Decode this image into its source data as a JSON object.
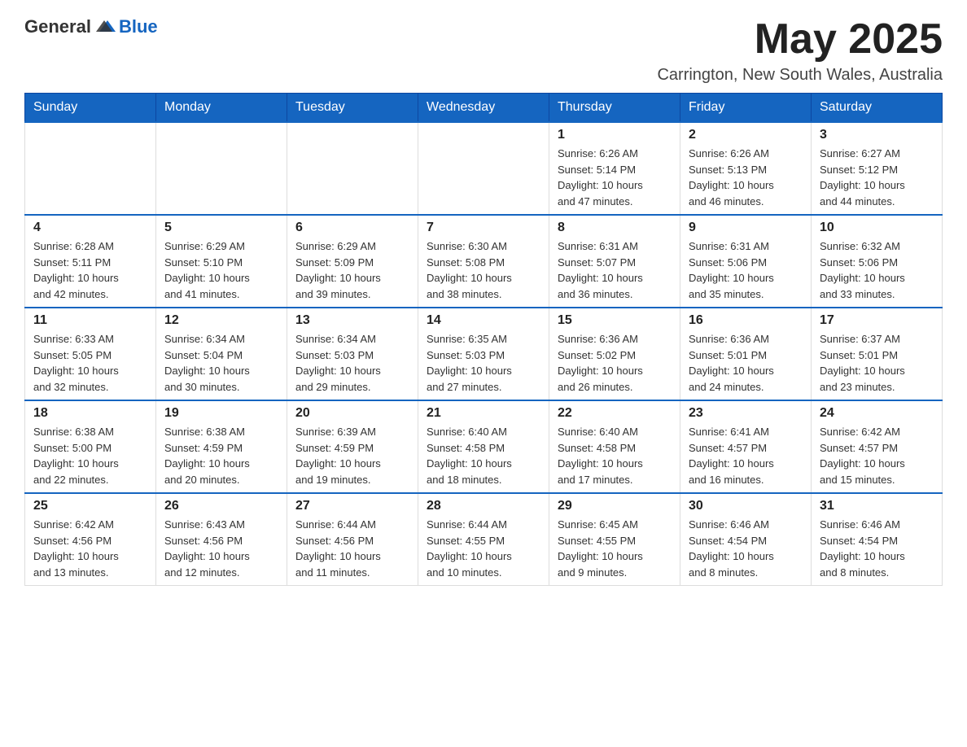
{
  "header": {
    "logo_general": "General",
    "logo_blue": "Blue",
    "month_title": "May 2025",
    "location": "Carrington, New South Wales, Australia"
  },
  "days_of_week": [
    "Sunday",
    "Monday",
    "Tuesday",
    "Wednesday",
    "Thursday",
    "Friday",
    "Saturday"
  ],
  "weeks": [
    [
      {
        "day": "",
        "info": ""
      },
      {
        "day": "",
        "info": ""
      },
      {
        "day": "",
        "info": ""
      },
      {
        "day": "",
        "info": ""
      },
      {
        "day": "1",
        "info": "Sunrise: 6:26 AM\nSunset: 5:14 PM\nDaylight: 10 hours\nand 47 minutes."
      },
      {
        "day": "2",
        "info": "Sunrise: 6:26 AM\nSunset: 5:13 PM\nDaylight: 10 hours\nand 46 minutes."
      },
      {
        "day": "3",
        "info": "Sunrise: 6:27 AM\nSunset: 5:12 PM\nDaylight: 10 hours\nand 44 minutes."
      }
    ],
    [
      {
        "day": "4",
        "info": "Sunrise: 6:28 AM\nSunset: 5:11 PM\nDaylight: 10 hours\nand 42 minutes."
      },
      {
        "day": "5",
        "info": "Sunrise: 6:29 AM\nSunset: 5:10 PM\nDaylight: 10 hours\nand 41 minutes."
      },
      {
        "day": "6",
        "info": "Sunrise: 6:29 AM\nSunset: 5:09 PM\nDaylight: 10 hours\nand 39 minutes."
      },
      {
        "day": "7",
        "info": "Sunrise: 6:30 AM\nSunset: 5:08 PM\nDaylight: 10 hours\nand 38 minutes."
      },
      {
        "day": "8",
        "info": "Sunrise: 6:31 AM\nSunset: 5:07 PM\nDaylight: 10 hours\nand 36 minutes."
      },
      {
        "day": "9",
        "info": "Sunrise: 6:31 AM\nSunset: 5:06 PM\nDaylight: 10 hours\nand 35 minutes."
      },
      {
        "day": "10",
        "info": "Sunrise: 6:32 AM\nSunset: 5:06 PM\nDaylight: 10 hours\nand 33 minutes."
      }
    ],
    [
      {
        "day": "11",
        "info": "Sunrise: 6:33 AM\nSunset: 5:05 PM\nDaylight: 10 hours\nand 32 minutes."
      },
      {
        "day": "12",
        "info": "Sunrise: 6:34 AM\nSunset: 5:04 PM\nDaylight: 10 hours\nand 30 minutes."
      },
      {
        "day": "13",
        "info": "Sunrise: 6:34 AM\nSunset: 5:03 PM\nDaylight: 10 hours\nand 29 minutes."
      },
      {
        "day": "14",
        "info": "Sunrise: 6:35 AM\nSunset: 5:03 PM\nDaylight: 10 hours\nand 27 minutes."
      },
      {
        "day": "15",
        "info": "Sunrise: 6:36 AM\nSunset: 5:02 PM\nDaylight: 10 hours\nand 26 minutes."
      },
      {
        "day": "16",
        "info": "Sunrise: 6:36 AM\nSunset: 5:01 PM\nDaylight: 10 hours\nand 24 minutes."
      },
      {
        "day": "17",
        "info": "Sunrise: 6:37 AM\nSunset: 5:01 PM\nDaylight: 10 hours\nand 23 minutes."
      }
    ],
    [
      {
        "day": "18",
        "info": "Sunrise: 6:38 AM\nSunset: 5:00 PM\nDaylight: 10 hours\nand 22 minutes."
      },
      {
        "day": "19",
        "info": "Sunrise: 6:38 AM\nSunset: 4:59 PM\nDaylight: 10 hours\nand 20 minutes."
      },
      {
        "day": "20",
        "info": "Sunrise: 6:39 AM\nSunset: 4:59 PM\nDaylight: 10 hours\nand 19 minutes."
      },
      {
        "day": "21",
        "info": "Sunrise: 6:40 AM\nSunset: 4:58 PM\nDaylight: 10 hours\nand 18 minutes."
      },
      {
        "day": "22",
        "info": "Sunrise: 6:40 AM\nSunset: 4:58 PM\nDaylight: 10 hours\nand 17 minutes."
      },
      {
        "day": "23",
        "info": "Sunrise: 6:41 AM\nSunset: 4:57 PM\nDaylight: 10 hours\nand 16 minutes."
      },
      {
        "day": "24",
        "info": "Sunrise: 6:42 AM\nSunset: 4:57 PM\nDaylight: 10 hours\nand 15 minutes."
      }
    ],
    [
      {
        "day": "25",
        "info": "Sunrise: 6:42 AM\nSunset: 4:56 PM\nDaylight: 10 hours\nand 13 minutes."
      },
      {
        "day": "26",
        "info": "Sunrise: 6:43 AM\nSunset: 4:56 PM\nDaylight: 10 hours\nand 12 minutes."
      },
      {
        "day": "27",
        "info": "Sunrise: 6:44 AM\nSunset: 4:56 PM\nDaylight: 10 hours\nand 11 minutes."
      },
      {
        "day": "28",
        "info": "Sunrise: 6:44 AM\nSunset: 4:55 PM\nDaylight: 10 hours\nand 10 minutes."
      },
      {
        "day": "29",
        "info": "Sunrise: 6:45 AM\nSunset: 4:55 PM\nDaylight: 10 hours\nand 9 minutes."
      },
      {
        "day": "30",
        "info": "Sunrise: 6:46 AM\nSunset: 4:54 PM\nDaylight: 10 hours\nand 8 minutes."
      },
      {
        "day": "31",
        "info": "Sunrise: 6:46 AM\nSunset: 4:54 PM\nDaylight: 10 hours\nand 8 minutes."
      }
    ]
  ]
}
